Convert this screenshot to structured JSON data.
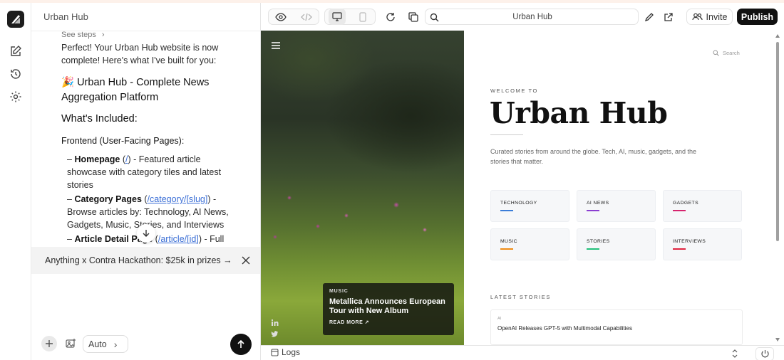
{
  "chat": {
    "title": "Urban Hub",
    "see_steps": "See steps",
    "intro": "Perfect! Your Urban Hub website is now complete! Here's what I've built for you:",
    "heading": "🎉 Urban Hub - Complete News Aggregation Platform",
    "included": "What's Included:",
    "frontend": "Frontend (User-Facing Pages):",
    "items": [
      {
        "name": "Homepage",
        "link": "/",
        "desc": " - Featured article showcase with category tiles and latest stories"
      },
      {
        "name": "Category Pages",
        "link": "/category/[slug]",
        "desc": " - Browse articles by: Technology, AI News, Gadgets, Music, Stories, and Interviews"
      },
      {
        "name": "Article Detail Page",
        "link": "/article/[id]",
        "desc": " - Full"
      }
    ],
    "banner": "Anything x Contra Hackathon: $25k in prizes →",
    "mode": "Auto"
  },
  "toolbar": {
    "url": "Urban Hub",
    "invite": "Invite",
    "publish": "Publish"
  },
  "site": {
    "search": "Search",
    "welcome": "WELCOME TO",
    "brand": "Urban Hub",
    "tagline": "Curated stories from around the globe. Tech, AI, music, gadgets, and the stories that matter.",
    "featured": {
      "category": "MUSIC",
      "title": "Metallica Announces European Tour with New Album",
      "cta": "READ MORE"
    },
    "categories": [
      {
        "label": "TECHNOLOGY",
        "color": "#3b7dd8"
      },
      {
        "label": "AI NEWS",
        "color": "#8b3fd1"
      },
      {
        "label": "GADGETS",
        "color": "#d6246e"
      },
      {
        "label": "MUSIC",
        "color": "#f08c14"
      },
      {
        "label": "STORIES",
        "color": "#22c07a"
      },
      {
        "label": "INTERVIEWS",
        "color": "#e0243f"
      }
    ],
    "latest_label": "LATEST STORIES",
    "latest": [
      {
        "category": "AI",
        "title": "OpenAI Releases GPT-5 with Multimodal Capabilities"
      }
    ]
  },
  "logs": {
    "label": "Logs"
  }
}
